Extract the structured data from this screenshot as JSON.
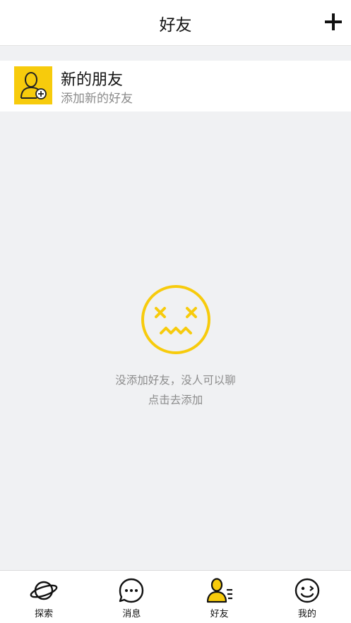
{
  "header": {
    "title": "好友",
    "add_icon": "plus-icon"
  },
  "new_friends": {
    "title": "新的朋友",
    "subtitle": "添加新的好友",
    "icon": "add-person-icon",
    "icon_bg": "#f7cb0c"
  },
  "empty_state": {
    "icon": "dizzy-face-icon",
    "line1": "没添加好友，没人可以聊",
    "line2": "点击去添加",
    "accent": "#f7cb0c"
  },
  "tabbar": {
    "tabs": [
      {
        "label": "探索",
        "icon": "planet-icon",
        "active": false
      },
      {
        "label": "消息",
        "icon": "chat-bubble-icon",
        "active": false
      },
      {
        "label": "好友",
        "icon": "friends-list-icon",
        "active": true
      },
      {
        "label": "我的",
        "icon": "wink-face-icon",
        "active": false
      }
    ]
  }
}
